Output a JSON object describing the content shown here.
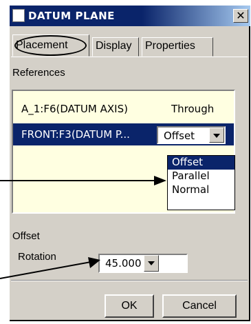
{
  "window": {
    "title": "DATUM PLANE",
    "close_glyph": "✕"
  },
  "tabs": [
    {
      "label": "Placement",
      "active": true
    },
    {
      "label": "Display"
    },
    {
      "label": "Properties"
    }
  ],
  "references": {
    "label": "References",
    "rows": [
      {
        "name": "A_1:F6(DATUM AXIS)",
        "type": "Through"
      },
      {
        "name": "FRONT:F3(DATUM P...",
        "type": "Offset",
        "selected": true
      }
    ],
    "dropdown": {
      "options": [
        "Offset",
        "Parallel",
        "Normal"
      ],
      "selected": "Offset"
    }
  },
  "offset": {
    "label": "Offset",
    "rotation_label": "Rotation",
    "rotation_value": "45.000"
  },
  "buttons": {
    "ok": "OK",
    "cancel": "Cancel"
  },
  "icons": {
    "title": "window-icon",
    "close": "close-icon",
    "combo": "chevron-down-icon"
  },
  "colors": {
    "titlebar": "#0a246a",
    "face": "#d4d0c8",
    "list_bg": "#ffffe1",
    "highlight": "#0a246a"
  }
}
